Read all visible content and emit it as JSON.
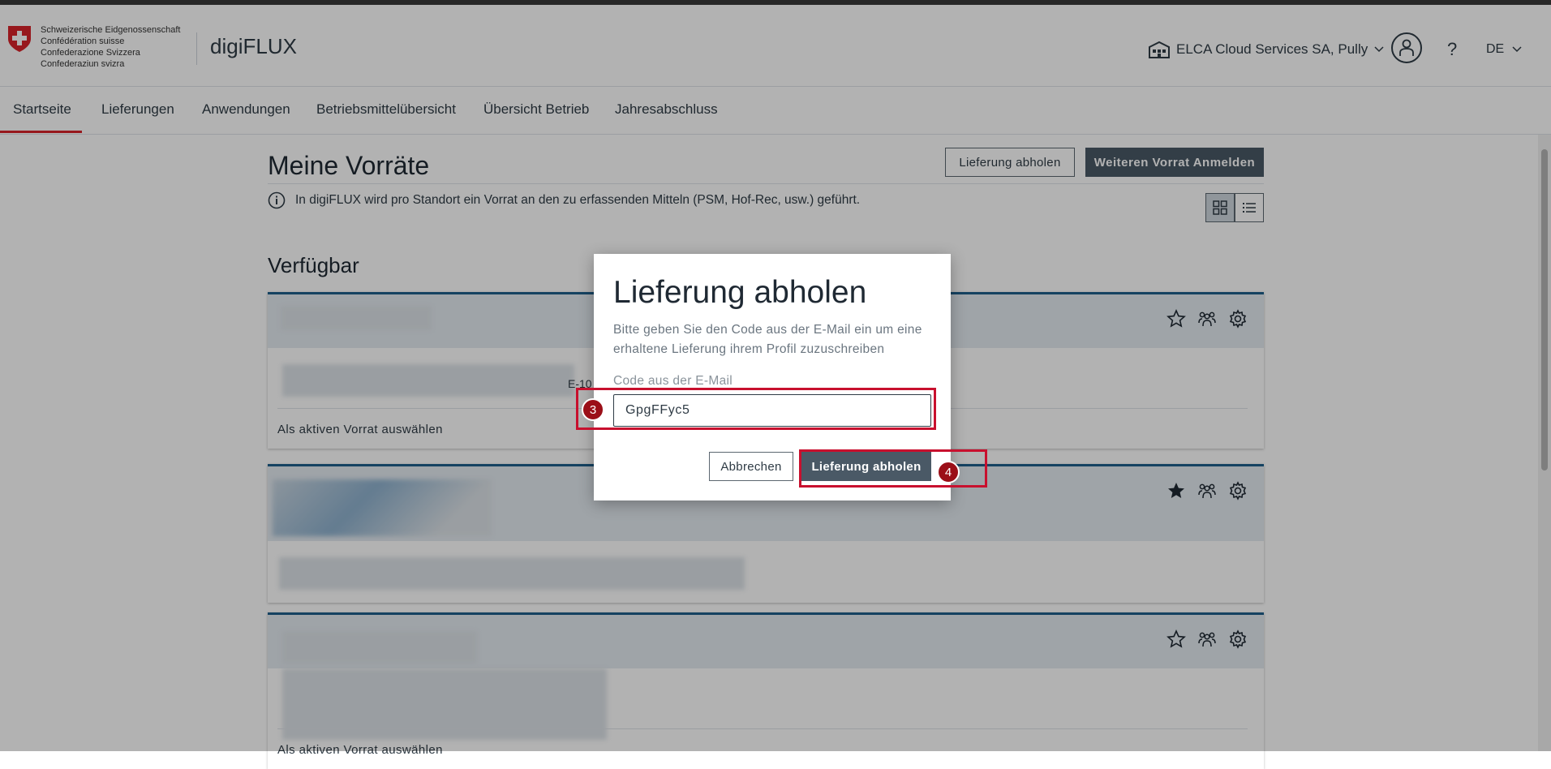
{
  "header": {
    "confederation_lines": [
      "Schweizerische Eidgenossenschaft",
      "Confédération suisse",
      "Confederazione Svizzera",
      "Confederaziun svizra"
    ],
    "brand": "digiFLUX",
    "organization": "ELCA Cloud Services SA, Pully",
    "help": "?",
    "language": "DE"
  },
  "nav": {
    "items": [
      "Startseite",
      "Lieferungen",
      "Anwendungen",
      "Betriebsmittelübersicht",
      "Übersicht Betrieb",
      "Jahresabschluss"
    ],
    "active": "Startseite"
  },
  "main": {
    "title": "Meine Vorräte",
    "pickup_button": "Lieferung abholen",
    "register_button": "Weiteren Vorrat Anmelden",
    "info_text": "In digiFLUX wird pro Standort ein Vorrat an den zu erfassenden Mitteln (PSM, Hof-Rec, usw.) geführt.",
    "section_title": "Verfügbar",
    "card_action": "Als aktiven Vorrat auswählen",
    "partial_fragment": "E-10"
  },
  "dialog": {
    "title": "Lieferung abholen",
    "description": "Bitte geben Sie den Code aus der E-Mail ein um eine erhaltene Lieferung ihrem Profil zuzuschreiben",
    "field_label": "Code aus der E-Mail",
    "field_value": "GpgFFyc5",
    "cancel": "Abbrechen",
    "confirm": "Lieferung abholen"
  },
  "annotations": {
    "step_input": "3",
    "step_confirm": "4"
  },
  "colors": {
    "primary": "#4a5966",
    "accent_red": "#d8232a",
    "card_border": "#1f5f8b",
    "annotation": "#c8102e"
  }
}
